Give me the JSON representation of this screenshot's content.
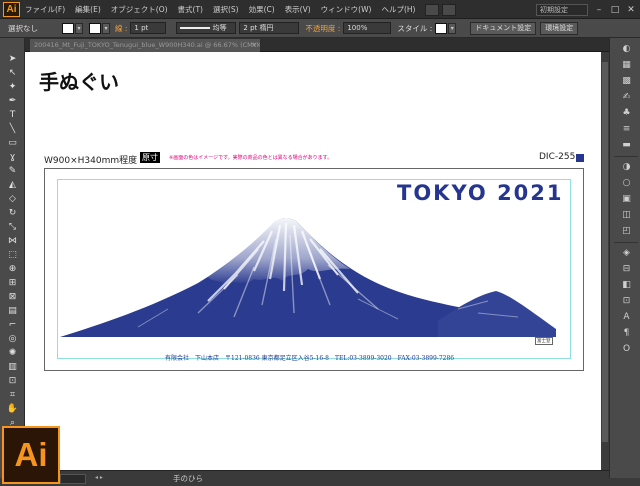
{
  "app": {
    "logo": "Ai",
    "workspace": "初期設定"
  },
  "menu": [
    "ファイル(F)",
    "編集(E)",
    "オブジェクト(O)",
    "書式(T)",
    "選択(S)",
    "効果(C)",
    "表示(V)",
    "ウィンドウ(W)",
    "ヘルプ(H)"
  ],
  "control": {
    "selection": "選択なし",
    "stroke_label": "線 :",
    "stroke_weight": "1 pt",
    "stroke_profile": "均等",
    "brush": "2 pt 楕円",
    "opacity_label": "不透明度 :",
    "opacity": "100%",
    "style_label": "スタイル :",
    "doc_setup": "ドキュメント設定",
    "prefs": "環境設定"
  },
  "tab": {
    "title": "200416_Mt_Fuji_TOKYO_Tenugui_blue_W900H340.ai @ 66.67% (CMYK/プレビュー)"
  },
  "document": {
    "title": "手ぬぐい",
    "size": "W900×H340mm程度",
    "genshi": "原寸",
    "note": "※画面の色はイメージです。実際の商品の色とは異なる場合があります。",
    "product_code": "DIC-255",
    "headline": "TOKYO 2021",
    "seal": "富士登",
    "footer": "有限会社　下山本店　〒121-0836 東京都足立区入谷5-16-8　TEL:03-3899-3020　FAX:03-3899-7286"
  },
  "colors": {
    "brand_blue": "#26368f",
    "ai_orange": "#f7941d"
  },
  "status": {
    "tool_name": "手のひら"
  },
  "icons": {
    "tools": [
      "selection-arrow-icon",
      "direct-select-icon",
      "magic-wand-icon",
      "lasso-icon",
      "pen-icon",
      "type-icon",
      "line-icon",
      "rectangle-icon",
      "paintbrush-icon",
      "pencil-icon",
      "blob-brush-icon",
      "eraser-icon",
      "rotate-icon",
      "scale-icon",
      "width-icon",
      "free-transform-icon",
      "shape-builder-icon",
      "perspective-icon",
      "mesh-icon",
      "gradient-icon",
      "eyedropper-icon",
      "blend-icon",
      "symbol-sprayer-icon",
      "graph-icon",
      "artboard-icon",
      "slice-icon",
      "hand-icon",
      "zoom-icon"
    ],
    "panels": [
      "color-icon",
      "color-guide-icon",
      "swatches-icon",
      "brushes-icon",
      "symbols-icon",
      "stroke-icon",
      "gradient-panel-icon",
      "transparency-icon",
      "appearance-icon",
      "graphic-styles-icon",
      "layers-icon",
      "artboards-panel-icon"
    ]
  }
}
